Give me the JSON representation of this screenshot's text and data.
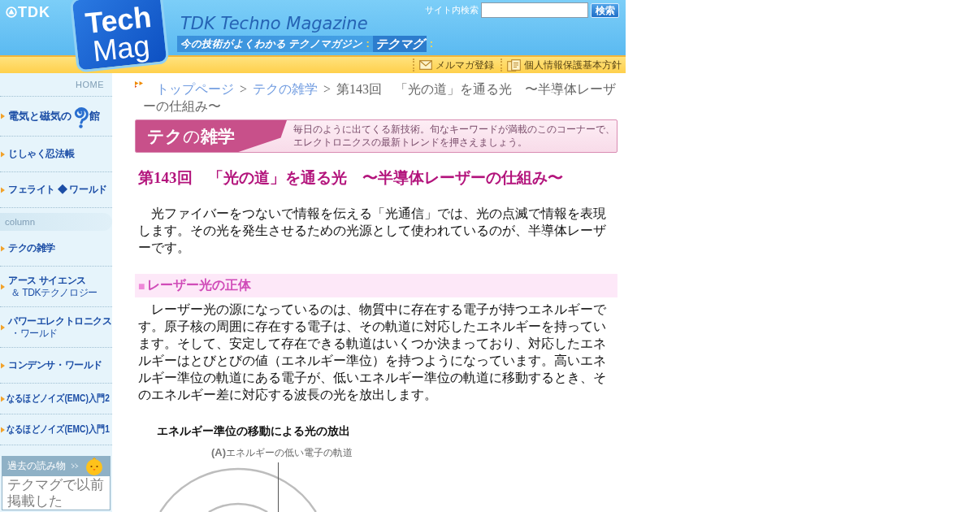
{
  "header": {
    "brand": "TDK",
    "logo": [
      "Tech",
      "Mag"
    ],
    "title": "TDK Techno Magazine",
    "tagline": [
      {
        "kind": "phrase",
        "text": "今の技術がよくわかる テクノマガジン"
      },
      {
        "kind": "mark",
        "text": ":"
      },
      {
        "kind": "name",
        "text": "テクマグ"
      },
      {
        "kind": "mark",
        "text": ":"
      }
    ],
    "search": {
      "label": "サイト内検索",
      "button": "検索"
    },
    "links": [
      {
        "kind": "newsletter",
        "label": "メルマガ登録"
      },
      {
        "kind": "policy",
        "label": "個人情報保護基本方針"
      }
    ]
  },
  "sidebar": {
    "items": [
      {
        "kind": "home",
        "label": "HOME"
      },
      {
        "kind": "logo",
        "label": "電気と磁気の",
        "label_after": "館"
      },
      {
        "kind": "link",
        "label": "じしゃく忍法帳"
      },
      {
        "kind": "link",
        "label": "フェライト ◆ ワールド"
      },
      {
        "kind": "section",
        "label": "column"
      },
      {
        "kind": "link",
        "label": "テクの雑学"
      },
      {
        "kind": "link",
        "label": "アース サイエンス",
        "sublabel": "＆ TDKテクノロジー"
      },
      {
        "kind": "link",
        "label": "パワーエレクトロニクス",
        "sublabel": "・ワールド"
      },
      {
        "kind": "link",
        "label": "コンデンサ・ワールド"
      },
      {
        "kind": "compact",
        "label": "なるほどノイズ(EMC)入門2"
      },
      {
        "kind": "compact",
        "label": "なるほどノイズ(EMC)入門1"
      }
    ],
    "archive": {
      "title": "過去の読み物",
      "text": "テクマグで以前掲載した"
    }
  },
  "breadcrumb": [
    {
      "kind": "link",
      "text": "トップページ"
    },
    {
      "kind": "separator",
      "text": ">"
    },
    {
      "kind": "link",
      "text": "テクの雑学"
    },
    {
      "kind": "separator",
      "text": ">"
    },
    {
      "kind": "current",
      "text": "第143回　「光の道」を通る光　〜半導体レーザーの仕組み〜"
    }
  ],
  "banner": {
    "title": "**テク**の**雑学**",
    "lines": [
      "毎日のように出てくる新技術。旬なキーワードが満載のこのコーナーで、",
      "エレクトロニクスの最新トレンドを押さえましょう。"
    ]
  },
  "article": {
    "title": "第143回　「光の道」を通る光　〜半導体レーザーの仕組み〜",
    "blocks": [
      {
        "kind": "paragraph",
        "text": "　光ファイバーをつないで情報を伝える「光通信」では、光の点滅で情報を表現します。その光を発生させるための光源として使われているのが、半導体レーザーです。"
      },
      {
        "kind": "heading",
        "marker": "■",
        "text": "レーザー光の正体"
      },
      {
        "kind": "paragraph",
        "text": "　レーザー光の源になっているのは、物質中に存在する電子が持つエネルギーです。原子核の周囲に存在する電子は、その軌道に対応したエネルギーを持っています。そして、安定して存在できる軌道はいくつか決まっており、対応したエネルギーはとびとびの値（エネルギー準位）を持つようになっています。高いエネルギー準位の軌道にある電子が、低いエネルギー準位の軌道に移動するとき、そのエネルギー差に対応する波長の光を放出します。"
      },
      {
        "kind": "figure",
        "title": "エネルギー準位の移動による光の放出",
        "label": "**(A)**エネルギーの低い電子の軌道"
      }
    ]
  }
}
